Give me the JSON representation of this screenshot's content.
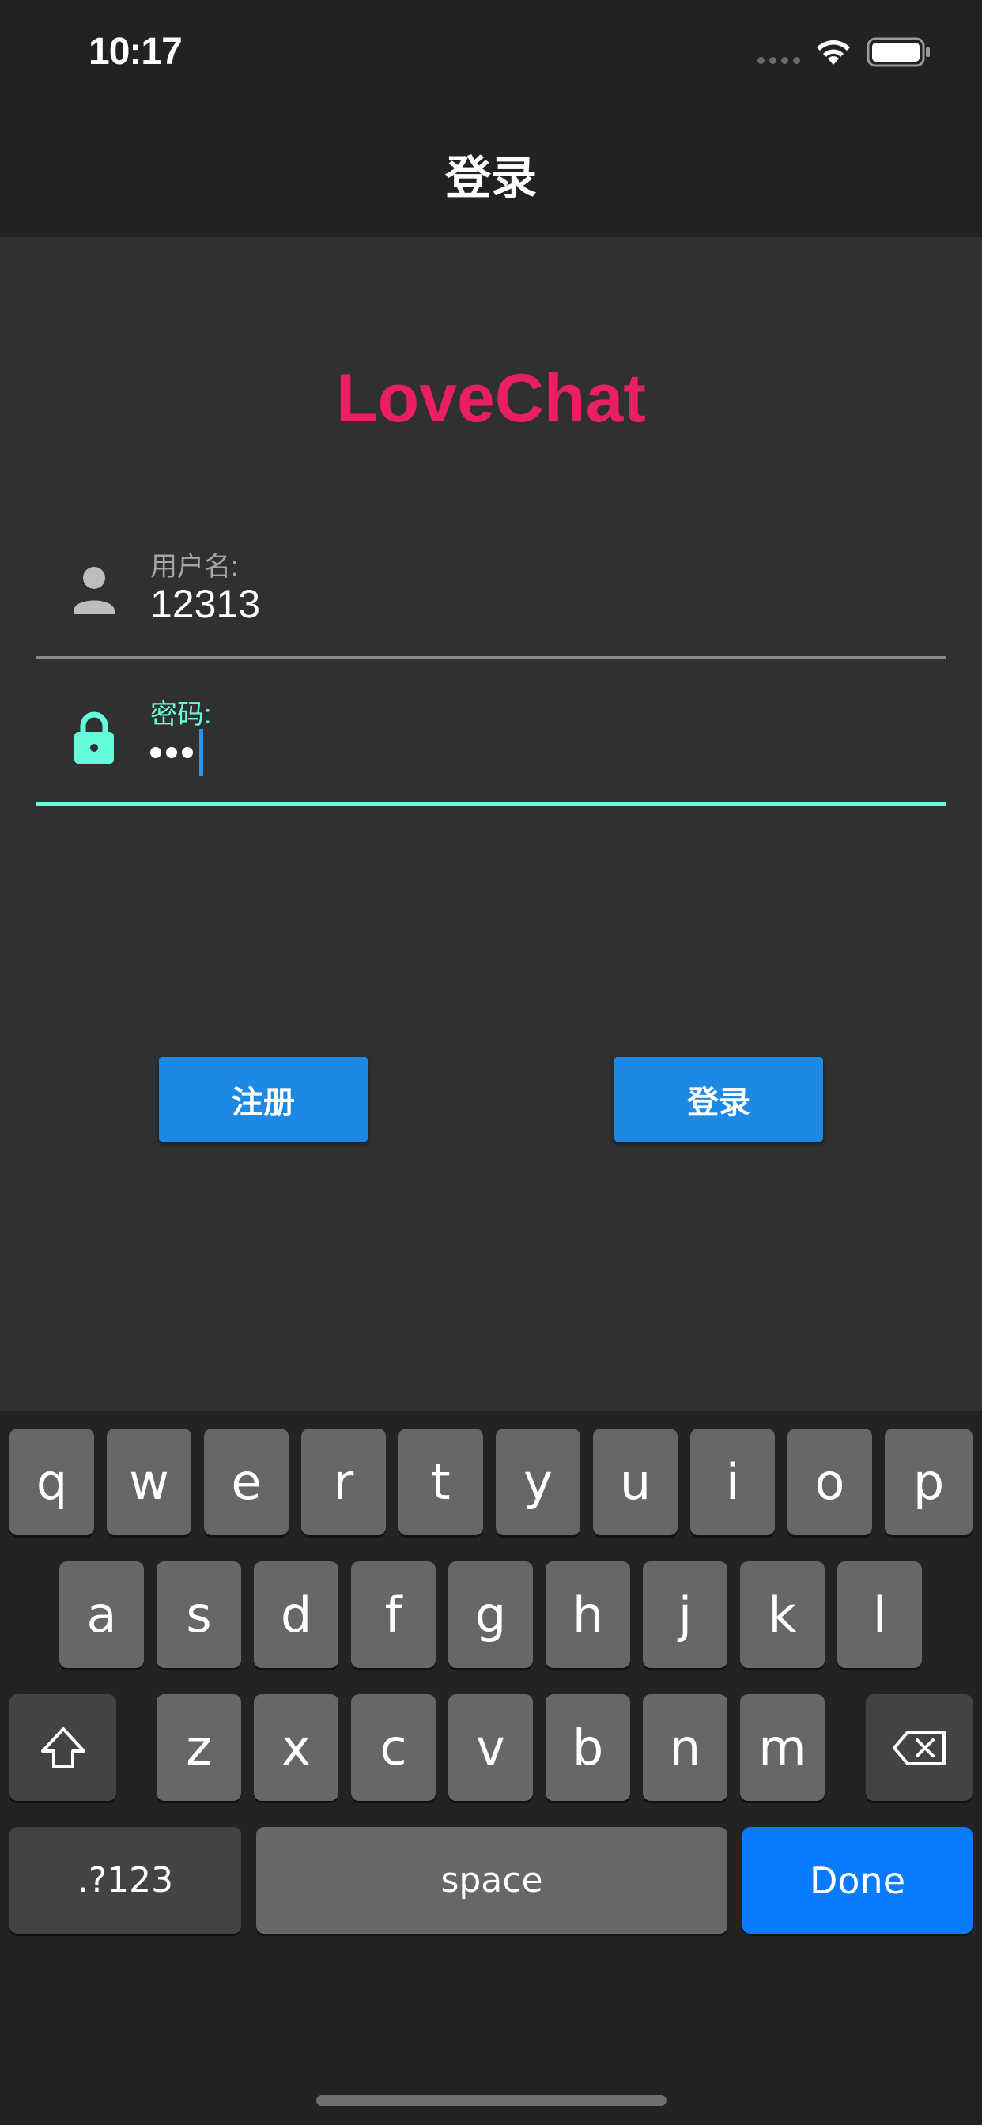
{
  "status_bar": {
    "time": "10:17"
  },
  "nav": {
    "title": "登录"
  },
  "app": {
    "title": "LoveChat",
    "title_color": "#e91e63"
  },
  "form": {
    "username": {
      "label": "用户名:",
      "value": "12313",
      "icon": "person-icon"
    },
    "password": {
      "label": "密码:",
      "masked_length": 3,
      "icon": "lock-icon",
      "focused": true
    }
  },
  "buttons": {
    "register": "注册",
    "login": "登录"
  },
  "keyboard": {
    "row1": [
      "q",
      "w",
      "e",
      "r",
      "t",
      "y",
      "u",
      "i",
      "o",
      "p"
    ],
    "row2": [
      "a",
      "s",
      "d",
      "f",
      "g",
      "h",
      "j",
      "k",
      "l"
    ],
    "row3": [
      "z",
      "x",
      "c",
      "v",
      "b",
      "n",
      "m"
    ],
    "shift_icon": "shift-icon",
    "delete_icon": "backspace-icon",
    "numbers": ".?123",
    "space": "space",
    "done": "Done"
  },
  "colors": {
    "accent_focus": "#64ffda",
    "button_bg": "#1e88e5",
    "done_key": "#0a7aff"
  }
}
